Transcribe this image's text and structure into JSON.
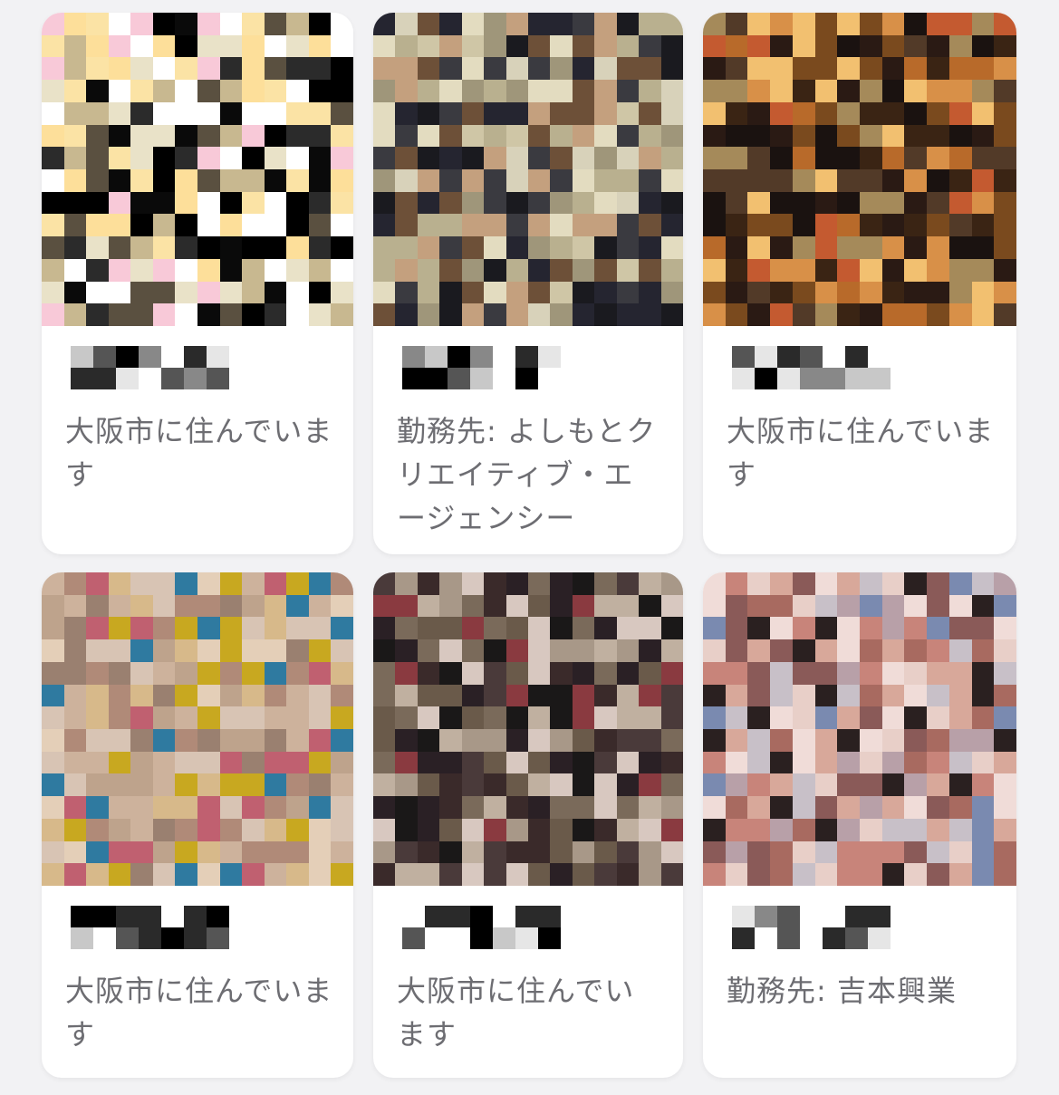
{
  "cards": [
    {
      "description": "大阪市に住んでいます",
      "palette": [
        "#000000",
        "#fddf9a",
        "#fbe3a5",
        "#2b2b2b",
        "#ffffff",
        "#f8c9d8",
        "#c8b890",
        "#5a5040",
        "#0a0a0a",
        "#e9e2c8"
      ]
    },
    {
      "description": "勤務先: よしもとクリエイティブ・エージェンシー",
      "palette": [
        "#cfc6a6",
        "#b9b08f",
        "#1a1a1f",
        "#252530",
        "#6d5038",
        "#e3dcc0",
        "#9f967a",
        "#c4a07e",
        "#3a3a40",
        "#d8d2ba"
      ]
    },
    {
      "description": "大阪市に住んでいます",
      "palette": [
        "#3a2414",
        "#7a4a1e",
        "#a58a5a",
        "#d89048",
        "#1a1210",
        "#b86a2a",
        "#f2c070",
        "#523a28",
        "#c45a30",
        "#2a1a14"
      ]
    },
    {
      "description": "大阪市に住んでいます",
      "palette": [
        "#cdb29c",
        "#bea38c",
        "#d7b98a",
        "#c8a820",
        "#2f7aa0",
        "#b08a78",
        "#d8c4b4",
        "#9a8070",
        "#c06070",
        "#e4cfb8"
      ]
    },
    {
      "description": "大阪市に住んでいます",
      "palette": [
        "#6a5a4a",
        "#3a2a2a",
        "#a89888",
        "#2a2025",
        "#8a3a40",
        "#c0b0a0",
        "#1a1818",
        "#d8c8c0",
        "#7a6a5a",
        "#4a3a3a"
      ]
    },
    {
      "description": "勤務先: 吉本興業",
      "palette": [
        "#c8847a",
        "#d8a89a",
        "#2a2020",
        "#e8cfc8",
        "#a86a60",
        "#7a8ab0",
        "#c8c0c8",
        "#f0dcd8",
        "#8a5a58",
        "#b8a0a8"
      ]
    }
  ]
}
